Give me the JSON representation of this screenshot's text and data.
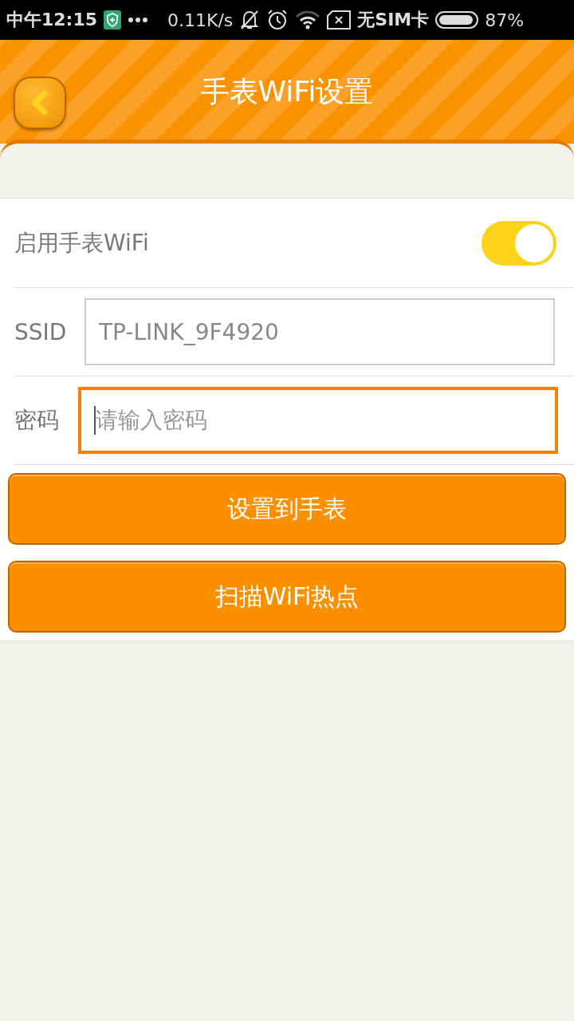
{
  "status_bar": {
    "time": "中午12:15",
    "speed": "0.11K/s",
    "sim": "无SIM卡",
    "battery": "87%"
  },
  "header": {
    "title": "手表WiFi设置"
  },
  "wifi_toggle": {
    "label": "启用手表WiFi",
    "on": true
  },
  "fields": [
    {
      "label": "SSID",
      "value": "TP-LINK_9F4920",
      "focused": false
    },
    {
      "label": "密码",
      "placeholder": "请输入密码",
      "focused": true
    }
  ],
  "buttons": [
    "设置到手表",
    "扫描WiFi热点"
  ]
}
